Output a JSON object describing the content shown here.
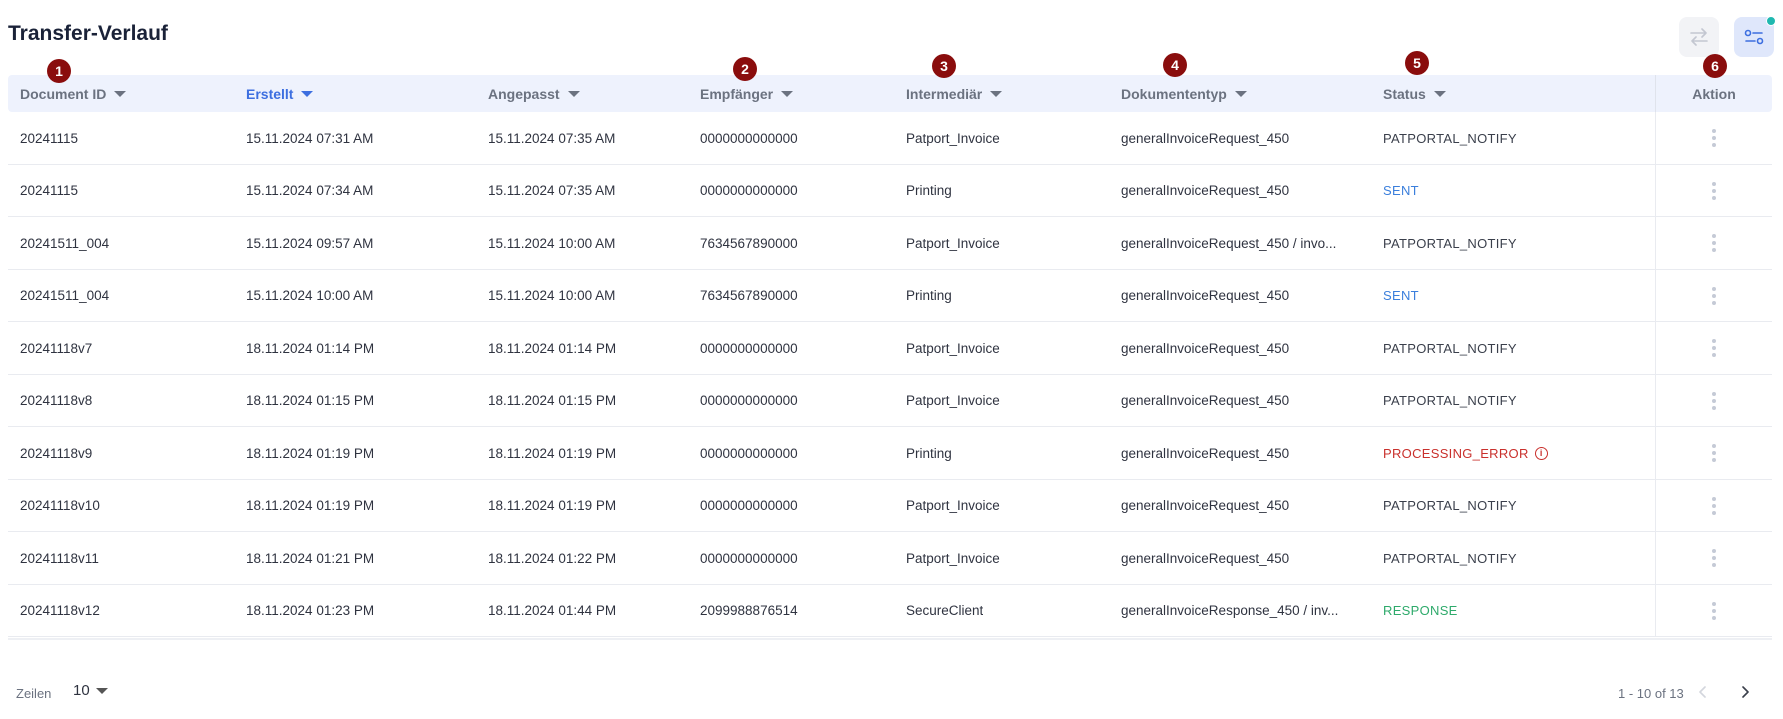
{
  "page": {
    "title": "Transfer-Verlauf"
  },
  "toolbar": {
    "transfer_icon": "arrows-left-right-icon",
    "filter_icon": "sliders-icon",
    "notification_color": "#1fb8b0"
  },
  "columns": [
    {
      "key": "document_id",
      "label": "Document ID",
      "sortable": true,
      "active": false
    },
    {
      "key": "erstellt",
      "label": "Erstellt",
      "sortable": true,
      "active": true
    },
    {
      "key": "angepasst",
      "label": "Angepasst",
      "sortable": true,
      "active": false
    },
    {
      "key": "empfaenger",
      "label": "Empfänger",
      "sortable": true,
      "active": false
    },
    {
      "key": "intermediaer",
      "label": "Intermediär",
      "sortable": true,
      "active": false
    },
    {
      "key": "dokumententyp",
      "label": "Dokumententyp",
      "sortable": true,
      "active": false
    },
    {
      "key": "status",
      "label": "Status",
      "sortable": true,
      "active": false
    },
    {
      "key": "aktion",
      "label": "Aktion",
      "sortable": false,
      "active": false
    }
  ],
  "rows": [
    {
      "document_id": "20241115",
      "erstellt": "15.11.2024 07:31 AM",
      "angepasst": "15.11.2024 07:35 AM",
      "empfaenger": "0000000000000",
      "intermediaer": "Patport_Invoice",
      "dokumententyp": "generalInvoiceRequest_450",
      "status": "PATPORTAL_NOTIFY",
      "status_kind": "notify"
    },
    {
      "document_id": "20241115",
      "erstellt": "15.11.2024 07:34 AM",
      "angepasst": "15.11.2024 07:35 AM",
      "empfaenger": "0000000000000",
      "intermediaer": "Printing",
      "dokumententyp": "generalInvoiceRequest_450",
      "status": "SENT",
      "status_kind": "sent"
    },
    {
      "document_id": "20241511_004",
      "erstellt": "15.11.2024 09:57 AM",
      "angepasst": "15.11.2024 10:00 AM",
      "empfaenger": "7634567890000",
      "intermediaer": "Patport_Invoice",
      "dokumententyp": "generalInvoiceRequest_450 / invo...",
      "status": "PATPORTAL_NOTIFY",
      "status_kind": "notify"
    },
    {
      "document_id": "20241511_004",
      "erstellt": "15.11.2024 10:00 AM",
      "angepasst": "15.11.2024 10:00 AM",
      "empfaenger": "7634567890000",
      "intermediaer": "Printing",
      "dokumententyp": "generalInvoiceRequest_450",
      "status": "SENT",
      "status_kind": "sent"
    },
    {
      "document_id": "20241118v7",
      "erstellt": "18.11.2024 01:14 PM",
      "angepasst": "18.11.2024 01:14 PM",
      "empfaenger": "0000000000000",
      "intermediaer": "Patport_Invoice",
      "dokumententyp": "generalInvoiceRequest_450",
      "status": "PATPORTAL_NOTIFY",
      "status_kind": "notify"
    },
    {
      "document_id": "20241118v8",
      "erstellt": "18.11.2024 01:15 PM",
      "angepasst": "18.11.2024 01:15 PM",
      "empfaenger": "0000000000000",
      "intermediaer": "Patport_Invoice",
      "dokumententyp": "generalInvoiceRequest_450",
      "status": "PATPORTAL_NOTIFY",
      "status_kind": "notify"
    },
    {
      "document_id": "20241118v9",
      "erstellt": "18.11.2024 01:19 PM",
      "angepasst": "18.11.2024 01:19 PM",
      "empfaenger": "0000000000000",
      "intermediaer": "Printing",
      "dokumententyp": "generalInvoiceRequest_450",
      "status": "PROCESSING_ERROR",
      "status_kind": "error"
    },
    {
      "document_id": "20241118v10",
      "erstellt": "18.11.2024 01:19 PM",
      "angepasst": "18.11.2024 01:19 PM",
      "empfaenger": "0000000000000",
      "intermediaer": "Patport_Invoice",
      "dokumententyp": "generalInvoiceRequest_450",
      "status": "PATPORTAL_NOTIFY",
      "status_kind": "notify"
    },
    {
      "document_id": "20241118v11",
      "erstellt": "18.11.2024 01:21 PM",
      "angepasst": "18.11.2024 01:22 PM",
      "empfaenger": "0000000000000",
      "intermediaer": "Patport_Invoice",
      "dokumententyp": "generalInvoiceRequest_450",
      "status": "PATPORTAL_NOTIFY",
      "status_kind": "notify"
    },
    {
      "document_id": "20241118v12",
      "erstellt": "18.11.2024 01:23 PM",
      "angepasst": "18.11.2024 01:44 PM",
      "empfaenger": "2099988876514",
      "intermediaer": "SecureClient",
      "dokumententyp": "generalInvoiceResponse_450 / inv...",
      "status": "RESPONSE",
      "status_kind": "response"
    }
  ],
  "markers": [
    "1",
    "2",
    "3",
    "4",
    "5",
    "6"
  ],
  "footer": {
    "rows_label": "Zeilen",
    "rows_value": "10",
    "page_info": "1 - 10 of 13"
  },
  "colors": {
    "accent": "#3d6fe0",
    "sent": "#3b7fdc",
    "error": "#c9302c",
    "response": "#2eaa6b",
    "marker": "#8a0d0d",
    "header_bg": "#eef2fd"
  }
}
